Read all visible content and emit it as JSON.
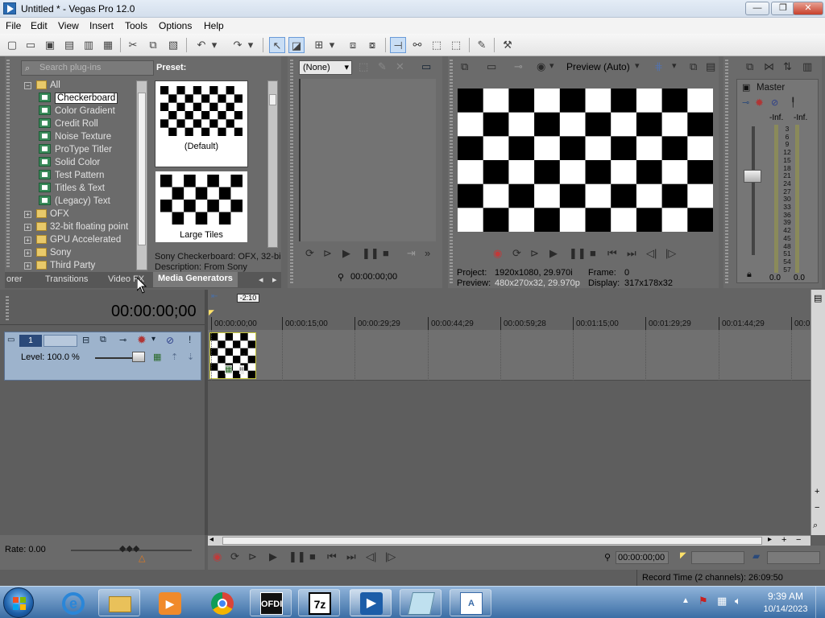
{
  "window": {
    "title": "Untitled * - Vegas Pro 12.0",
    "min": "—",
    "max": "❐",
    "close": "✕"
  },
  "menu": [
    "File",
    "Edit",
    "View",
    "Insert",
    "Tools",
    "Options",
    "Help"
  ],
  "toolbar_icons": [
    "new-icon",
    "open-icon",
    "save-icon",
    "save-as-icon",
    "properties-icon",
    "cut-icon",
    "copy-icon",
    "paste-icon",
    "delete-icon",
    "undo-icon",
    "redo-icon",
    "normal-edit-tool-icon",
    "envelope-tool-icon",
    "snapping-icon",
    "auto-ripple-icon",
    "lock-envelopes-icon",
    "crossfade-icon",
    "event-fx-icon",
    "help-icon"
  ],
  "plugin_browser": {
    "search_placeholder": "Search plug-ins",
    "tree": [
      {
        "label": "All",
        "level": 0,
        "kind": "folder",
        "expander": "−"
      },
      {
        "label": "Checkerboard",
        "level": 1,
        "kind": "plugin",
        "selected": true
      },
      {
        "label": "Color Gradient",
        "level": 1,
        "kind": "plugin"
      },
      {
        "label": "Credit Roll",
        "level": 1,
        "kind": "plugin"
      },
      {
        "label": "Noise Texture",
        "level": 1,
        "kind": "plugin"
      },
      {
        "label": "ProType Titler",
        "level": 1,
        "kind": "plugin"
      },
      {
        "label": "Solid Color",
        "level": 1,
        "kind": "plugin"
      },
      {
        "label": "Test Pattern",
        "level": 1,
        "kind": "plugin"
      },
      {
        "label": "Titles & Text",
        "level": 1,
        "kind": "plugin"
      },
      {
        "label": "(Legacy) Text",
        "level": 1,
        "kind": "plugin"
      },
      {
        "label": "OFX",
        "level": 0,
        "kind": "folder",
        "expander": "+"
      },
      {
        "label": "32-bit floating point",
        "level": 0,
        "kind": "folder",
        "expander": "+"
      },
      {
        "label": "GPU Accelerated",
        "level": 0,
        "kind": "folder",
        "expander": "+"
      },
      {
        "label": "Sony",
        "level": 0,
        "kind": "folder",
        "expander": "+"
      },
      {
        "label": "Third Party",
        "level": 0,
        "kind": "folder",
        "expander": "+"
      }
    ],
    "preset_header": "Preset:",
    "presets": [
      "(Default)",
      "Large Tiles"
    ],
    "info_line1": "Sony Checkerboard: OFX, 32-bi",
    "info_line2": "Description: From Sony Creative",
    "tabs": [
      "orer",
      "Transitions",
      "Video FX",
      "Media Generators"
    ],
    "active_tab": "Media Generators"
  },
  "trimmer": {
    "dropdown_value": "(None)",
    "timecode": "00:00:00;00"
  },
  "preview": {
    "mode": "Preview (Auto)",
    "project_label": "Project:",
    "project_value": "1920x1080, 29.970i",
    "frame_label": "Frame:",
    "frame_value": "0",
    "preview_label": "Preview:",
    "preview_value": "480x270x32, 29.970p",
    "display_label": "Display:",
    "display_value": "317x178x32"
  },
  "mixer": {
    "title": "Master",
    "left_peak": "-Inf.",
    "right_peak": "-Inf.",
    "scale": [
      "3",
      "6",
      "9",
      "12",
      "15",
      "18",
      "21",
      "24",
      "27",
      "30",
      "33",
      "36",
      "39",
      "42",
      "45",
      "48",
      "51",
      "54",
      "57"
    ],
    "left_value": "0.0",
    "right_value": "0.0"
  },
  "timeline": {
    "timecode": "00:00:00;00",
    "loop_marker": "-2:10",
    "ruler": [
      "00:00:00;00",
      "00:00:15;00",
      "00:00:29;29",
      "00:00:44;29",
      "00:00:59;28",
      "00:01:15;00",
      "00:01:29;29",
      "00:01:44;29",
      "00:0"
    ],
    "track_number": "1",
    "level_label": "Level: 100.0 %",
    "rate_label": "Rate: 0.00",
    "transport_timecode": "00:00:00;00"
  },
  "status": {
    "record_time": "Record Time (2 channels): 26:09:50"
  },
  "taskbar": {
    "apps": [
      "internet-explorer-icon",
      "file-explorer-icon",
      "media-player-icon",
      "chrome-icon",
      "ofdi-icon",
      "7zip-icon",
      "vegas-icon",
      "notepad-icon",
      "wordpad-icon"
    ],
    "ofdi_text": "OFDI",
    "zip_text": "7z",
    "time": "9:39 AM",
    "date": "10/14/2023"
  },
  "colors": {
    "panel": "#6b6b6b",
    "track_header": "#9db3cc",
    "accent": "#3b6ea5"
  }
}
